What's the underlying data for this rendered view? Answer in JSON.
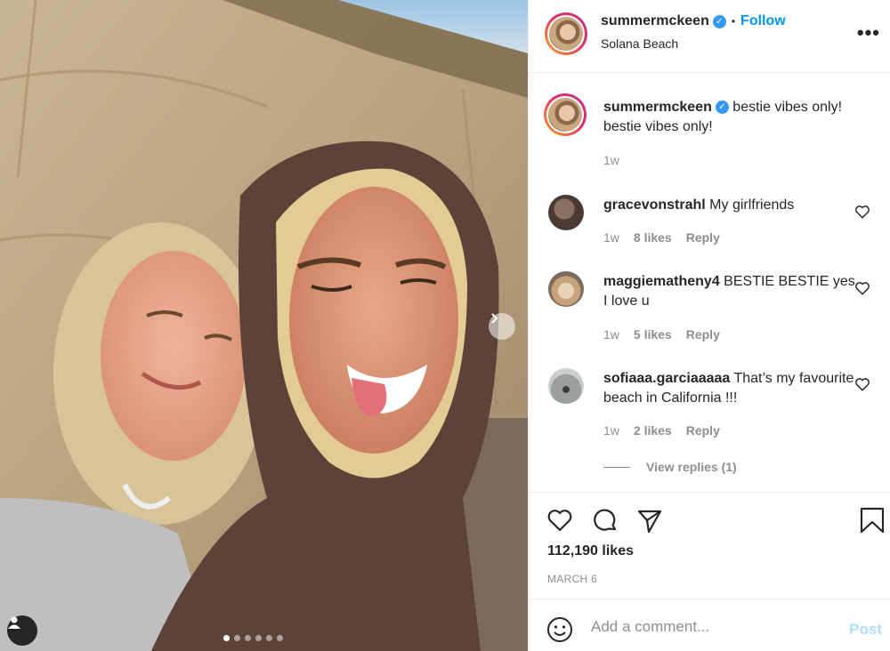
{
  "post": {
    "username": "summermckeen",
    "follow_label": "Follow",
    "dot": "•",
    "location": "Solana Beach",
    "more_label": "•••",
    "caption": "bestie vibes only! bestie vibes only!",
    "caption_time": "1w",
    "likes_total": "112,190 likes",
    "date": "MARCH 6",
    "carousel_count": 6,
    "carousel_active": 0
  },
  "comments": [
    {
      "username": "gracevonstrahl",
      "text": "My girlfriends",
      "time": "1w",
      "likes": "8 likes",
      "reply": "Reply"
    },
    {
      "username": "maggiematheny4",
      "text": "BESTIE BESTIE yes I love u",
      "time": "1w",
      "likes": "5 likes",
      "reply": "Reply"
    },
    {
      "username": "sofiaaa.garciaaaaa",
      "text": "That’s my favourite beach in California !!!",
      "time": "1w",
      "likes": "2 likes",
      "reply": "Reply",
      "view_replies": "View replies (1)"
    }
  ],
  "composer": {
    "placeholder": "Add a comment...",
    "post_label": "Post"
  },
  "colors": {
    "accent": "#0095f6",
    "verified": "#3897f0",
    "muted": "#8e8e8e",
    "post_disabled": "#b2dffc"
  },
  "icons": [
    "next-arrow-icon",
    "user-tag-icon",
    "verified-badge-icon",
    "heart-icon",
    "comment-icon",
    "share-icon",
    "bookmark-icon",
    "emoji-icon"
  ]
}
